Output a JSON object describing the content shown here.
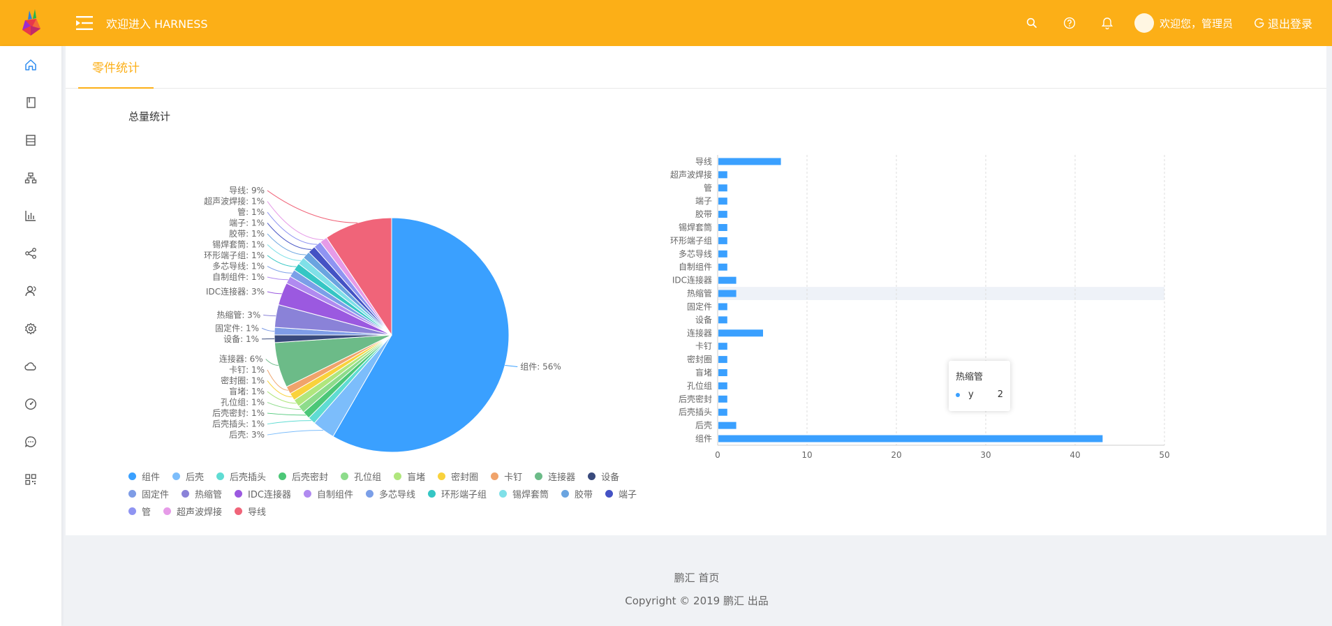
{
  "header": {
    "title": "欢迎进入 HARNESS",
    "user_label": "欢迎您，管理员",
    "logout_label": "退出登录"
  },
  "colors": {
    "brand": "#fcaf17",
    "bar": "#3aa0ff"
  },
  "sidebar": {
    "icons": [
      "home-icon",
      "book-icon",
      "list-icon",
      "org-tree-icon",
      "bar-chart-icon",
      "share-icon",
      "user-icon",
      "settings-icon",
      "cloud-icon",
      "dashboard-icon",
      "chat-icon",
      "qrcode-icon"
    ]
  },
  "tabs": [
    {
      "label": "零件统计"
    }
  ],
  "section_title": "总量统计",
  "chart_data": [
    {
      "type": "pie",
      "title": "",
      "legend_position": "bottom-left",
      "slices": [
        {
          "name": "组件",
          "percent": 56,
          "label": "组件: 56%",
          "color": "#3aa0ff"
        },
        {
          "name": "后壳",
          "percent": 3,
          "label": "后壳: 3%",
          "color": "#7cbdfb"
        },
        {
          "name": "后壳插头",
          "percent": 1,
          "label": "后壳插头: 1%",
          "color": "#5fdcd3"
        },
        {
          "name": "后壳密封",
          "percent": 1,
          "label": "后壳密封: 1%",
          "color": "#4cc777"
        },
        {
          "name": "孔位组",
          "percent": 1,
          "label": "孔位组: 1%",
          "color": "#8ddc8b"
        },
        {
          "name": "盲堵",
          "percent": 1,
          "label": "盲堵: 1%",
          "color": "#b0e67d"
        },
        {
          "name": "密封圈",
          "percent": 1,
          "label": "密封圈: 1%",
          "color": "#f9d23c"
        },
        {
          "name": "卡钉",
          "percent": 1,
          "label": "卡钉: 1%",
          "color": "#f0a36b"
        },
        {
          "name": "连接器",
          "percent": 6,
          "label": "连接器: 6%",
          "color": "#6cbb88"
        },
        {
          "name": "设备",
          "percent": 1,
          "label": "设备: 1%",
          "color": "#394a7c"
        },
        {
          "name": "固定件",
          "percent": 1,
          "label": "固定件: 1%",
          "color": "#7e9ce6"
        },
        {
          "name": "热缩管",
          "percent": 3,
          "label": "热缩管: 3%",
          "color": "#8a82d8"
        },
        {
          "name": "IDC连接器",
          "percent": 3,
          "label": "IDC连接器: 3%",
          "color": "#9b59e0"
        },
        {
          "name": "自制组件",
          "percent": 1,
          "label": "自制组件: 1%",
          "color": "#b08af0"
        },
        {
          "name": "多芯导线",
          "percent": 1,
          "label": "多芯导线: 1%",
          "color": "#7b9fe8"
        },
        {
          "name": "环形端子组",
          "percent": 1,
          "label": "环形端子组: 1%",
          "color": "#35c6c4"
        },
        {
          "name": "锡焊套筒",
          "percent": 1,
          "label": "锡焊套筒: 1%",
          "color": "#7fe0e8"
        },
        {
          "name": "胶带",
          "percent": 1,
          "label": "胶带: 1%",
          "color": "#6aa4e0"
        },
        {
          "name": "端子",
          "percent": 1,
          "label": "端子: 1%",
          "color": "#4452c4"
        },
        {
          "name": "管",
          "percent": 1,
          "label": "管: 1%",
          "color": "#8f94f2"
        },
        {
          "name": "超声波焊接",
          "percent": 1,
          "label": "超声波焊接: 1%",
          "color": "#e69be8"
        },
        {
          "name": "导线",
          "percent": 9,
          "label": "导线: 9%",
          "color": "#f06479"
        }
      ]
    },
    {
      "type": "bar",
      "orientation": "horizontal",
      "grid": true,
      "xlim": [
        0,
        50
      ],
      "x_ticks": [
        "0",
        "10",
        "20",
        "30",
        "40",
        "50"
      ],
      "categories": [
        "导线",
        "超声波焊接",
        "管",
        "端子",
        "胶带",
        "锡焊套筒",
        "环形端子组",
        "多芯导线",
        "自制组件",
        "IDC连接器",
        "热缩管",
        "固定件",
        "设备",
        "连接器",
        "卡钉",
        "密封圈",
        "盲堵",
        "孔位组",
        "后壳密封",
        "后壳插头",
        "后壳",
        "组件"
      ],
      "values": [
        7,
        1,
        1,
        1,
        1,
        1,
        1,
        1,
        1,
        2,
        2,
        1,
        1,
        5,
        1,
        1,
        1,
        1,
        1,
        1,
        2,
        43
      ],
      "highlighted_category": "热缩管"
    }
  ],
  "tooltip": {
    "title": "热缩管",
    "series": "y",
    "value": "2"
  },
  "footer": {
    "line1": "鹏汇 首页",
    "line2": "Copyright © 2019 鹏汇 出品"
  }
}
